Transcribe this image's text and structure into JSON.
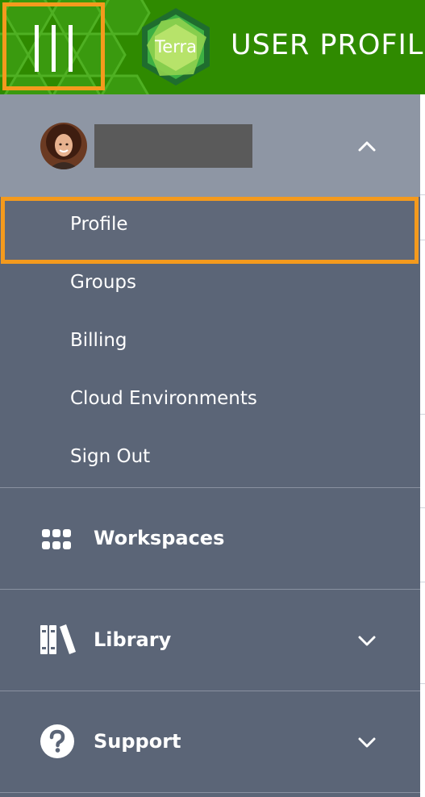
{
  "header": {
    "title": "USER PROFILE",
    "logo_text": "Terra",
    "menu_icon": "hamburger-bars-icon",
    "colors": {
      "header_bg": "#2f8a00",
      "highlight": "#f49a1d"
    }
  },
  "drawer": {
    "user": {
      "avatar_icon": "user-avatar",
      "name": "",
      "expand_icon": "chevron-up-icon"
    },
    "user_menu": [
      {
        "label": "Profile",
        "active": true
      },
      {
        "label": "Groups"
      },
      {
        "label": "Billing"
      },
      {
        "label": "Cloud Environments"
      },
      {
        "label": "Sign Out"
      }
    ],
    "nav": [
      {
        "label": "Workspaces",
        "icon": "workspaces-grid-icon"
      },
      {
        "label": "Library",
        "icon": "library-books-icon",
        "chevron": "chevron-down-icon"
      },
      {
        "label": "Support",
        "icon": "help-circle-icon",
        "chevron": "chevron-down-icon"
      }
    ],
    "colors": {
      "drawer_bg": "#5b6577",
      "user_row_bg": "#8e96a4"
    }
  }
}
